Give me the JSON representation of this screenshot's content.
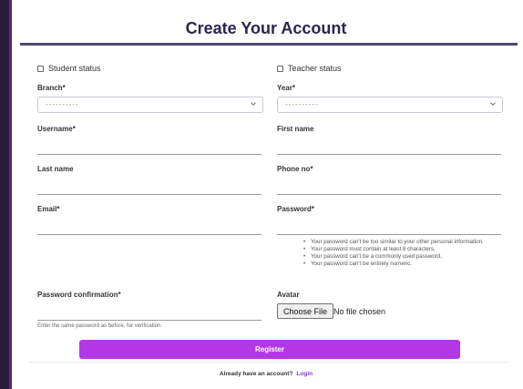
{
  "page": {
    "title": "Create Your Account"
  },
  "form": {
    "student_status_label": "Student status",
    "teacher_status_label": "Teacher status",
    "branch": {
      "label": "Branch*",
      "placeholder": "----------"
    },
    "year": {
      "label": "Year*",
      "placeholder": "----------"
    },
    "username_label": "Username*",
    "first_name_label": "First name",
    "last_name_label": "Last name",
    "phone_label": "Phone no*",
    "email_label": "Email*",
    "password_label": "Password*",
    "password_help": [
      "Your password can't be too similar to your other personal information.",
      "Your password must contain at least 8 characters.",
      "Your password can't be a commonly used password.",
      "Your password can't be entirely numeric."
    ],
    "password_confirmation_label": "Password confirmation*",
    "password_confirmation_help": "Enter the same password as before, for verification.",
    "avatar_label": "Avatar",
    "file_button_label": "Choose File",
    "file_status": "No file chosen",
    "register_label": "Register"
  },
  "footer": {
    "prompt": "Already have an account?",
    "login_label": "Login"
  },
  "colors": {
    "accent": "#b437e6",
    "title": "#2d2450",
    "link": "#7b3fc8"
  },
  "icons": {
    "select_arrow": "chevron-down-icon"
  }
}
